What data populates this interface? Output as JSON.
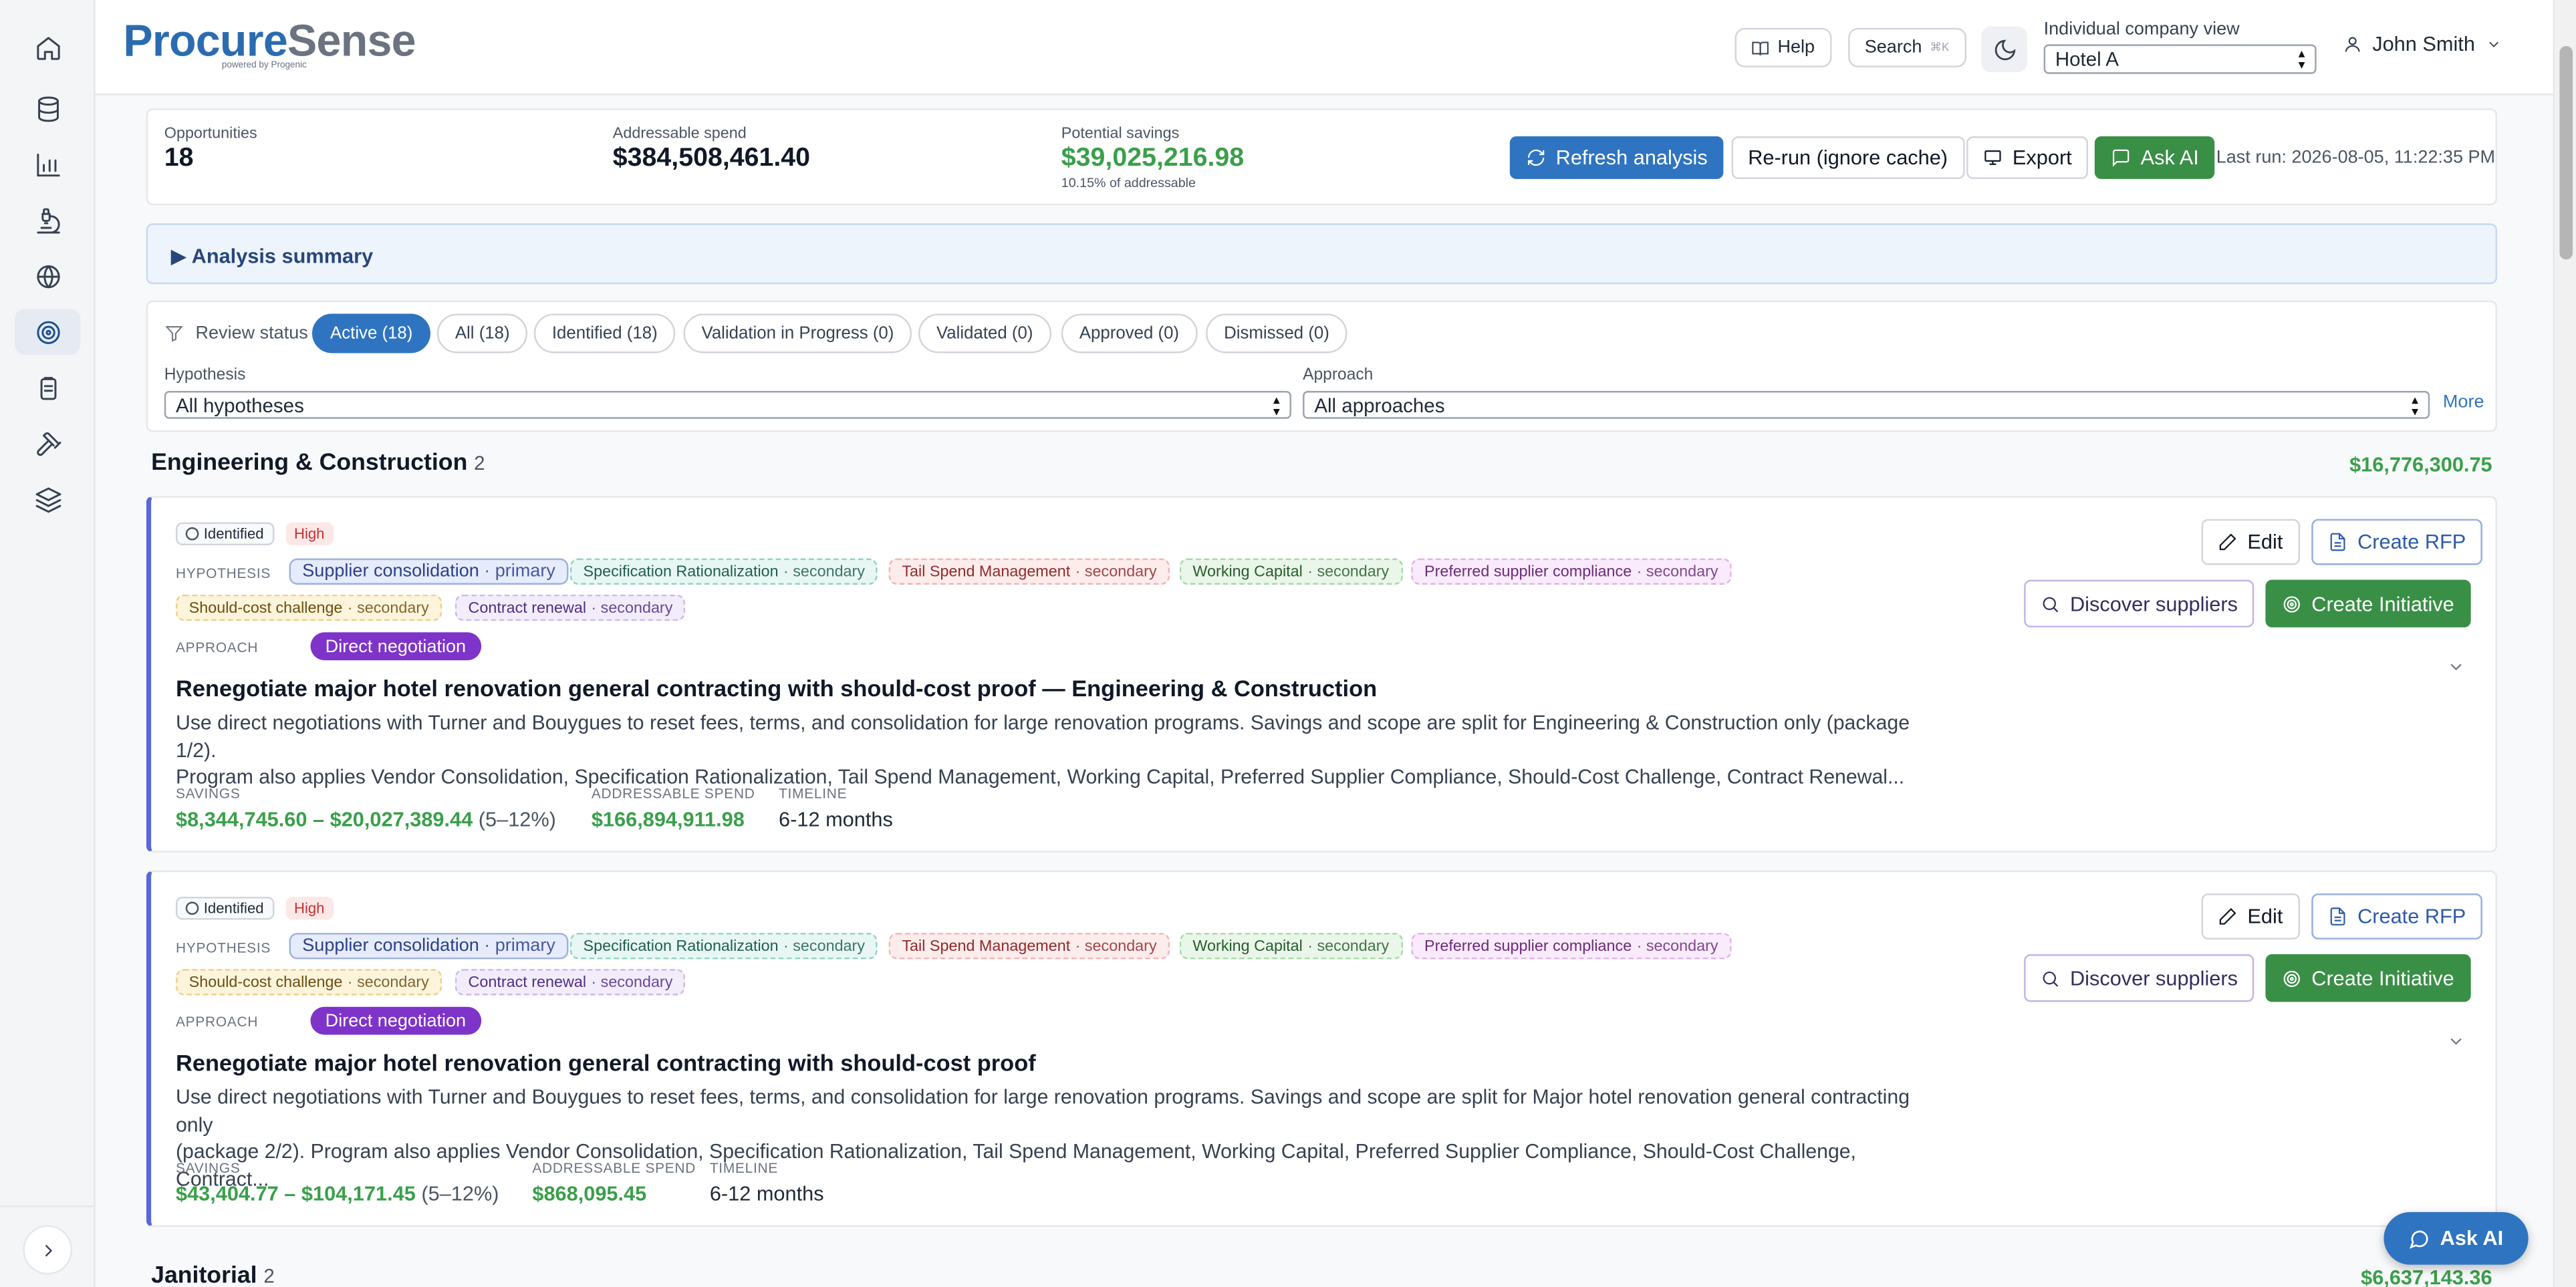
{
  "brand": {
    "name_part1": "Procure",
    "name_part2": "Sense",
    "tagline": "powered by Progenic"
  },
  "header": {
    "help_label": "Help",
    "search_label": "Search",
    "search_shortcut": "⌘K",
    "company_view_label": "Individual company view",
    "company_view_value": "Hotel A",
    "user_name": "John Smith"
  },
  "sidebar": {
    "items": [
      {
        "icon": "home-icon"
      },
      {
        "icon": "database-icon"
      },
      {
        "icon": "bar-chart-icon"
      },
      {
        "icon": "microscope-icon"
      },
      {
        "icon": "globe-icon"
      },
      {
        "icon": "target-icon",
        "active": true
      },
      {
        "icon": "clipboard-icon"
      },
      {
        "icon": "hammer-icon"
      },
      {
        "icon": "layers-icon"
      }
    ]
  },
  "stats": {
    "opportunities_label": "Opportunities",
    "opportunities_value": "18",
    "addressable_label": "Addressable spend",
    "addressable_value": "$384,508,461.40",
    "savings_label": "Potential savings",
    "savings_value": "$39,025,216.98",
    "savings_sub": "10.15% of addressable",
    "refresh_label": "Refresh analysis",
    "rerun_label": "Re-run (ignore cache)",
    "export_label": "Export",
    "askai_label": "Ask AI",
    "last_run": "Last run: 2026-08-05, 11:22:35 PM"
  },
  "summary": {
    "label": "▶ Analysis summary"
  },
  "filters": {
    "review_label": "Review status",
    "pills": [
      "Active (18)",
      "All (18)",
      "Identified (18)",
      "Validation in Progress (0)",
      "Validated (0)",
      "Approved (0)",
      "Dismissed (0)"
    ],
    "hypothesis_label": "Hypothesis",
    "hypothesis_value": "All hypotheses",
    "approach_label": "Approach",
    "approach_value": "All approaches",
    "more_label": "More"
  },
  "groups": [
    {
      "title": "Engineering & Construction",
      "count": "2",
      "total": "$16,776,300.75"
    },
    {
      "title": "Janitorial",
      "count": "2",
      "total": "$6,637,143.36"
    }
  ],
  "labels": {
    "hypothesis": "HYPOTHESIS",
    "approach": "APPROACH",
    "savings": "SAVINGS",
    "addressable": "ADDRESSABLE SPEND",
    "timeline": "TIMELINE",
    "edit": "Edit",
    "create_rfp": "Create RFP",
    "discover": "Discover suppliers",
    "create_initiative": "Create Initiative"
  },
  "opportunities": [
    {
      "status": "Identified",
      "priority": "High",
      "tags": [
        {
          "name": "Supplier consolidation",
          "role": "· primary"
        },
        {
          "name": "Specification Rationalization",
          "role": "· secondary"
        },
        {
          "name": "Tail Spend Management",
          "role": "· secondary"
        },
        {
          "name": "Working Capital",
          "role": "· secondary"
        },
        {
          "name": "Preferred supplier compliance",
          "role": "· secondary"
        },
        {
          "name": "Should-cost challenge",
          "role": "· secondary"
        },
        {
          "name": "Contract renewal",
          "role": "· secondary"
        }
      ],
      "approach": "Direct negotiation",
      "title": "Renegotiate major hotel renovation general contracting with should-cost proof — Engineering & Construction",
      "desc1": "Use direct negotiations with Turner and Bouygues to reset fees, terms, and consolidation for large renovation programs. Savings and scope are split for Engineering & Construction only (package 1/2).",
      "desc2": "Program also applies Vendor Consolidation, Specification Rationalization, Tail Spend Management, Working Capital, Preferred Supplier Compliance, Should-Cost Challenge, Contract Renewal...",
      "savings": "$8,344,745.60 – $20,027,389.44",
      "savings_pct": "(5–12%)",
      "addressable": "$166,894,911.98",
      "timeline": "6-12 months"
    },
    {
      "status": "Identified",
      "priority": "High",
      "tags": [
        {
          "name": "Supplier consolidation",
          "role": "· primary"
        },
        {
          "name": "Specification Rationalization",
          "role": "· secondary"
        },
        {
          "name": "Tail Spend Management",
          "role": "· secondary"
        },
        {
          "name": "Working Capital",
          "role": "· secondary"
        },
        {
          "name": "Preferred supplier compliance",
          "role": "· secondary"
        },
        {
          "name": "Should-cost challenge",
          "role": "· secondary"
        },
        {
          "name": "Contract renewal",
          "role": "· secondary"
        }
      ],
      "approach": "Direct negotiation",
      "title": "Renegotiate major hotel renovation general contracting with should-cost proof",
      "desc1": "Use direct negotiations with Turner and Bouygues to reset fees, terms, and consolidation for large renovation programs. Savings and scope are split for Major hotel renovation general contracting only",
      "desc2": "(package 2/2). Program also applies Vendor Consolidation, Specification Rationalization, Tail Spend Management, Working Capital, Preferred Supplier Compliance, Should-Cost Challenge, Contract...",
      "savings": "$43,404.77 – $104,171.45",
      "savings_pct": "(5–12%)",
      "addressable": "$868,095.45",
      "timeline": "6-12 months"
    }
  ],
  "floating": {
    "askai_label": "Ask AI"
  }
}
